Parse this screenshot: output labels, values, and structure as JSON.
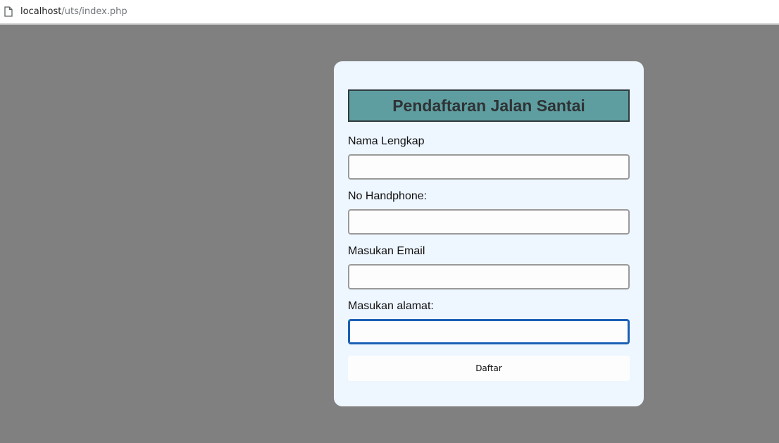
{
  "browser": {
    "url_host": "localhost",
    "url_path": "/uts/index.php"
  },
  "form": {
    "title": "Pendaftaran Jalan Santai",
    "fields": [
      {
        "label": "Nama Lengkap",
        "value": ""
      },
      {
        "label": "No Handphone:",
        "value": ""
      },
      {
        "label": "Masukan Email",
        "value": ""
      },
      {
        "label": "Masukan alamat:",
        "value": ""
      }
    ],
    "submit_label": "Daftar"
  },
  "colors": {
    "background": "#808080",
    "card": "#eef6ff",
    "title_bg": "#5f9ea0",
    "focus": "#1a5fb4"
  }
}
